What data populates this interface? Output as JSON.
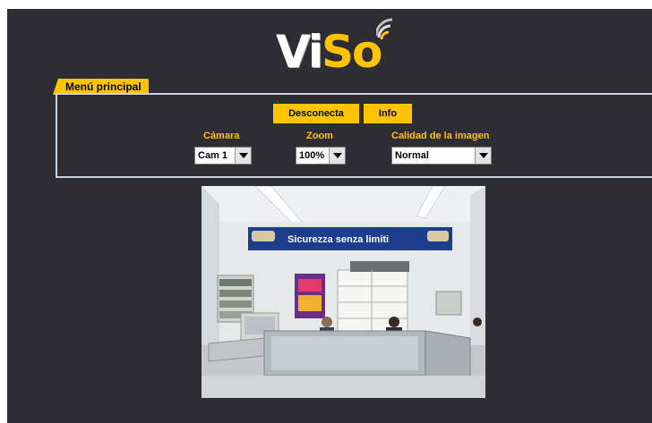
{
  "logo": {
    "part1": "Vi",
    "part2": "So"
  },
  "tab": {
    "label": "Menú principal"
  },
  "buttons": {
    "disconnect": "Desconecta",
    "info": "Info"
  },
  "controls": {
    "camera": {
      "label": "Cámara",
      "value": "Cam 1"
    },
    "zoom": {
      "label": "Zoom",
      "value": "100%"
    },
    "quality": {
      "label": "Calidad de la imagen",
      "value": "Normal"
    }
  },
  "camera_view": {
    "banner_text": "Sicurezza senza limiti"
  },
  "colors": {
    "accent": "#ffc400",
    "background": "#2d2d33",
    "panel_border": "#c6d4e4"
  }
}
